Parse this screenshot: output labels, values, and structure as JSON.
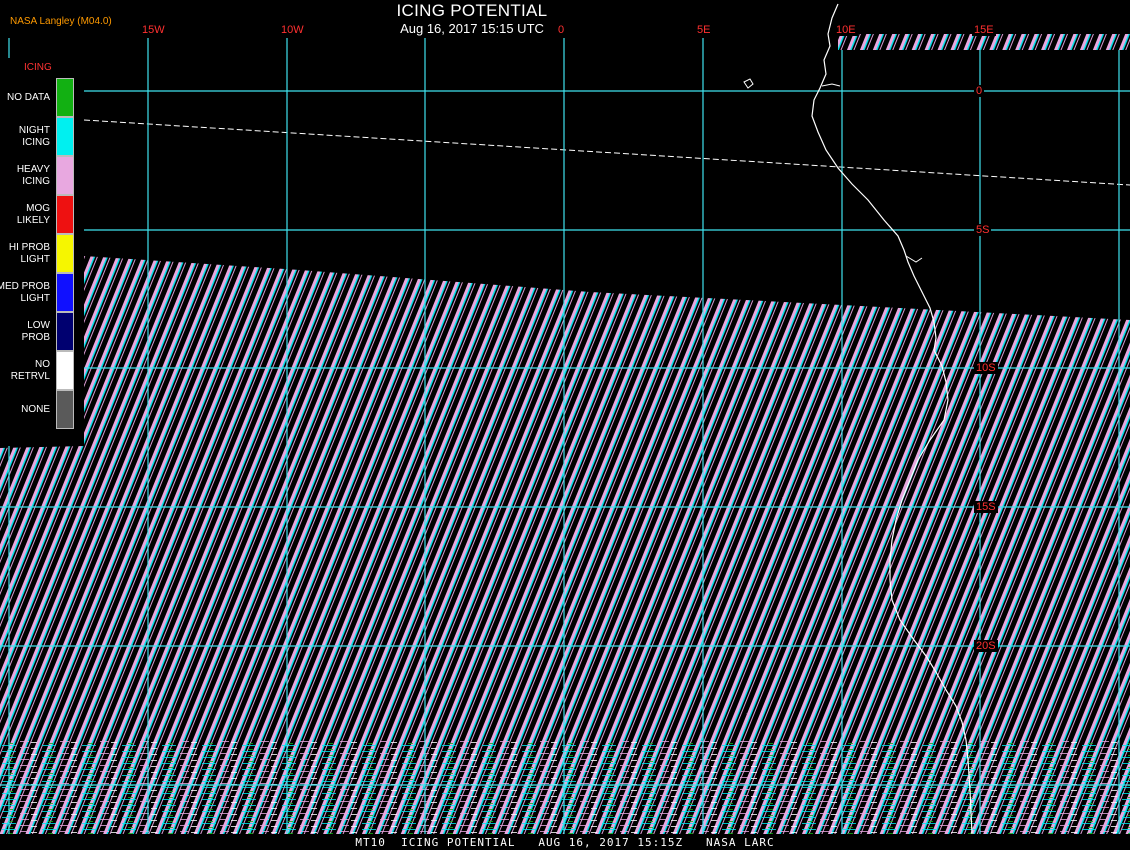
{
  "header": {
    "title": "ICING POTENTIAL",
    "datetime": "Aug 16, 2017 15:15 UTC",
    "source": "NASA Langley (M04.0)"
  },
  "legend": {
    "title": "ICING",
    "items": [
      {
        "label": "NO DATA",
        "color": "#12b012"
      },
      {
        "label": "NIGHT\nICING",
        "color": "#00f0f0"
      },
      {
        "label": "HEAVY\nICING",
        "color": "#e8a8e0"
      },
      {
        "label": "MOG\nLIKELY",
        "color": "#ee1111"
      },
      {
        "label": "HI PROB\nLIGHT",
        "color": "#f6f600"
      },
      {
        "label": "MED PROB\nLIGHT",
        "color": "#1010ff"
      },
      {
        "label": "LOW\nPROB",
        "color": "#000070"
      },
      {
        "label": "NO\nRETRVL",
        "color": "#ffffff"
      },
      {
        "label": "NONE",
        "color": "#5a5a5a"
      }
    ]
  },
  "longitude_labels": [
    "15W",
    "10W",
    "0",
    "5E",
    "10E",
    "15E"
  ],
  "latitude_labels": [
    "0",
    "5S",
    "10S",
    "15S",
    "20S"
  ],
  "footer": "MT10  ICING POTENTIAL   AUG 16, 2017 15:15Z   NASA LARC",
  "colors": {
    "grid": "#3fe3ee",
    "coordinate_label": "#ff3030",
    "coastline": "#ffffff",
    "stripe_heavy": "#e8a8e0",
    "stripe_night": "#00f0f0"
  }
}
